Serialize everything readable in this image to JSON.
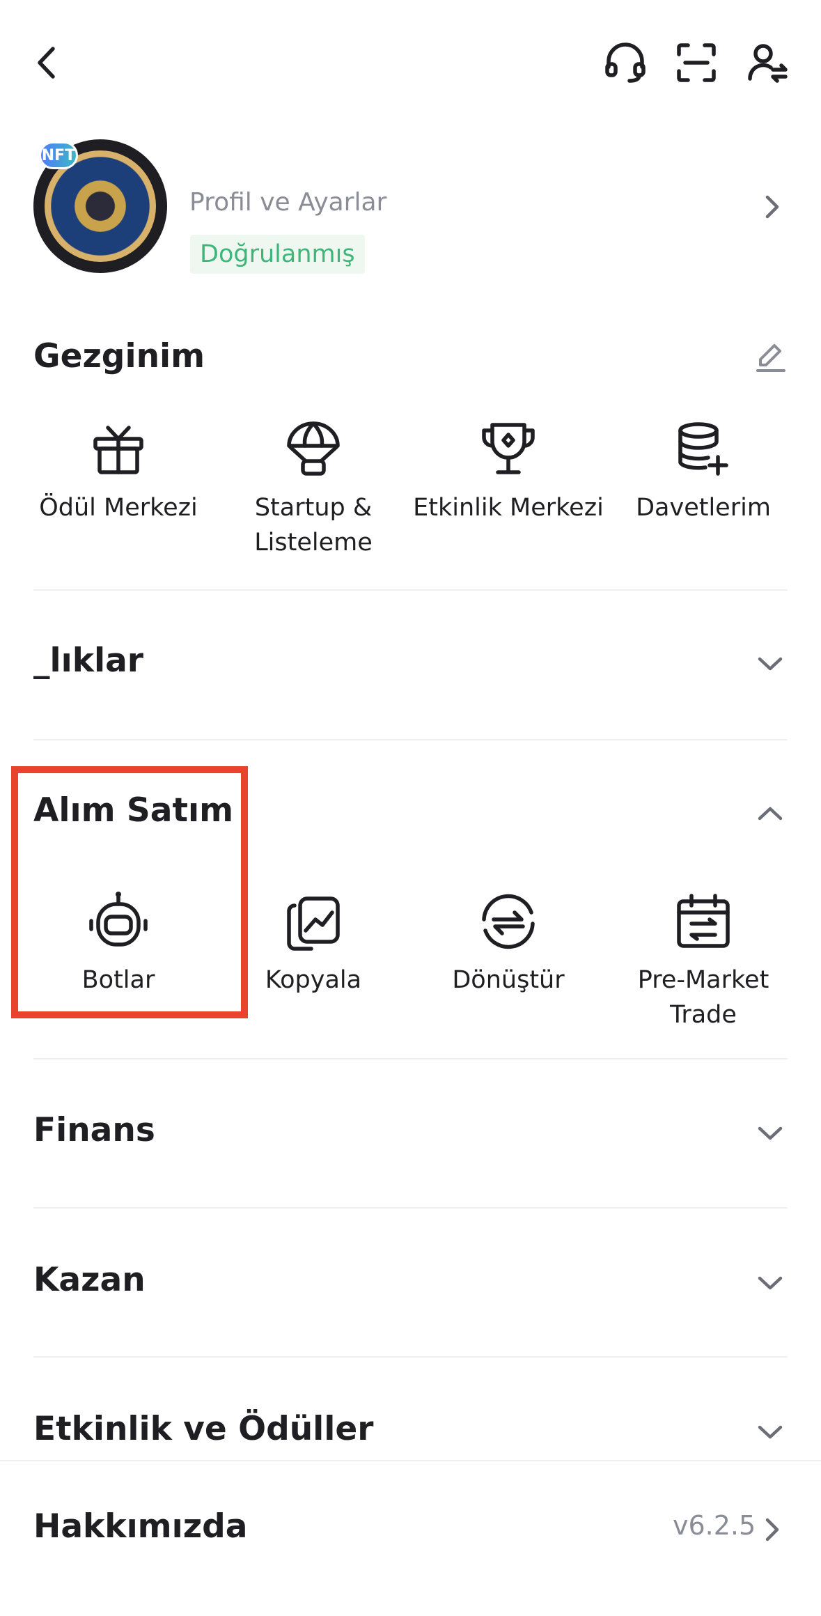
{
  "header": {
    "back_icon": "chevron-left-icon",
    "support_icon": "headset-icon",
    "scan_icon": "scan-icon",
    "switch_account_icon": "user-switch-icon"
  },
  "profile": {
    "badge": "NFT",
    "link_label": "Profil ve Ayarlar",
    "status": "Doğrulanmış"
  },
  "shortcuts": {
    "title": "Gezginim",
    "edit_icon": "pencil-icon",
    "items": [
      {
        "label": "Ödül Merkezi",
        "icon": "gift-icon"
      },
      {
        "label": "Startup & Listeleme",
        "icon": "parachute-icon"
      },
      {
        "label": "Etkinlik Merkezi",
        "icon": "trophy-icon"
      },
      {
        "label": "Davetlerim",
        "icon": "coins-plus-icon"
      }
    ]
  },
  "sections": {
    "s1": {
      "title": "_lıklar"
    },
    "trading": {
      "title": "Alım Satım",
      "items": [
        {
          "label": "Botlar",
          "icon": "robot-icon"
        },
        {
          "label": "Kopyala",
          "icon": "copy-chart-icon"
        },
        {
          "label": "Dönüştür",
          "icon": "convert-icon"
        },
        {
          "label": "Pre-Market Trade",
          "icon": "calendar-swap-icon"
        }
      ]
    },
    "finance": {
      "title": "Finans"
    },
    "earn": {
      "title": "Kazan"
    },
    "events": {
      "title": "Etkinlik ve Ödüller"
    }
  },
  "about": {
    "title": "Hakkımızda",
    "version": "v6.2.5"
  },
  "colors": {
    "highlight": "#e8432b",
    "verified": "#3fb57a",
    "muted": "#8a8d96"
  }
}
